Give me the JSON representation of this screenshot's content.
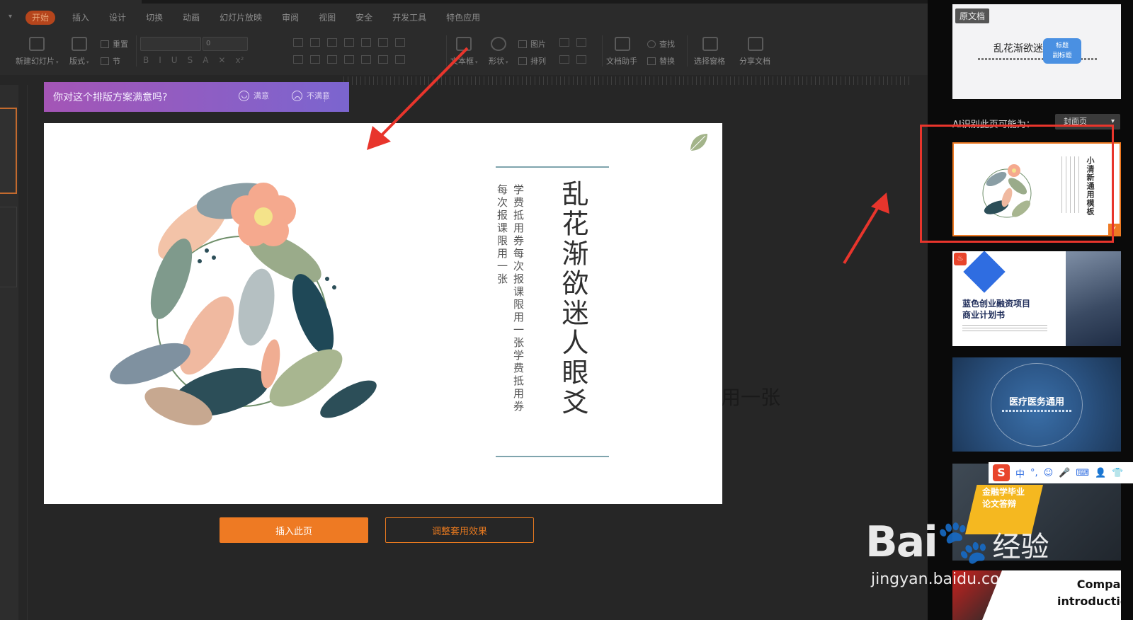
{
  "ribbon": {
    "tabs": [
      "开始",
      "插入",
      "设计",
      "切换",
      "动画",
      "幻灯片放映",
      "审阅",
      "视图",
      "安全",
      "开发工具",
      "特色应用"
    ],
    "active_tab": "开始",
    "tools": {
      "new_slide": "新建幻灯片",
      "layout": "版式",
      "reset": "重置",
      "section": "节",
      "font_size_value": "0",
      "textbox": "文本框",
      "shape": "形状",
      "picture": "图片",
      "arrange": "排列",
      "find": "查找",
      "replace": "替换",
      "doc_assistant": "文档助手",
      "select_pane": "选择窗格",
      "share_doc": "分享文档"
    }
  },
  "survey": {
    "question": "你对这个排版方案满意吗?",
    "satisfied": "满意",
    "unsatisfied": "不满意"
  },
  "slide": {
    "title": "乱花渐欲迷人眼爻",
    "subtitle_line1": "学费抵用券每次报课限用一张学费抵用券",
    "subtitle_line2": "每次报课限用一张",
    "overflow_text": "用一张"
  },
  "actions": {
    "insert": "插入此页",
    "adjust": "调整套用效果"
  },
  "right_panel": {
    "original_badge": "原文档",
    "original_title": "乱花渐欲迷",
    "original_tip_line1": "标题",
    "original_tip_line2": "副标题",
    "ai_label": "AI识别此页可能为：",
    "ai_select": "封面页",
    "templates": [
      {
        "title": "小清新通用模板"
      },
      {
        "title_line1": "蓝色创业融资项目",
        "title_line2": "商业计划书"
      },
      {
        "title": "医疗医务通用"
      },
      {
        "title_line1": "金融学毕业",
        "title_line2": "论文答辩"
      },
      {
        "title_line1": "Company",
        "title_line2": "introduction"
      }
    ]
  },
  "ime_bar": {
    "logo": "S",
    "mode": "中"
  },
  "watermark": {
    "logo": "Bai",
    "cn": "经验",
    "url": "jingyan.baidu.com"
  },
  "colors": {
    "accent_orange": "#ee7a23",
    "highlight_red": "#e8352c",
    "survey_start": "#a455b6",
    "survey_end": "#7b65cf",
    "slide_line": "#7fa4ad"
  }
}
